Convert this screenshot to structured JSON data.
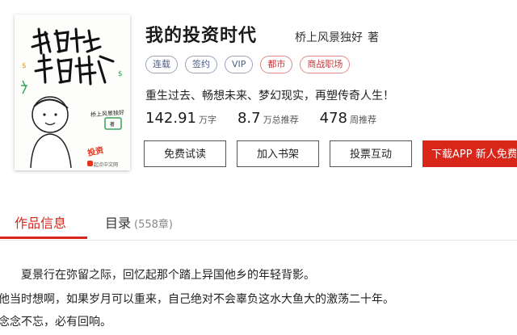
{
  "cover": {
    "title_art": "我的投资时代",
    "author": "桥上风景独好",
    "suffix": "著",
    "tag": "投资",
    "publisher": "起点中文网"
  },
  "book": {
    "title": "我的投资时代",
    "author": "桥上风景独好",
    "author_suffix": "著",
    "tags": [
      "连载",
      "签约",
      "VIP",
      "都市",
      "商战职场"
    ],
    "intro": "重生过去、畅想未来、梦幻现实，再塑传奇人生！",
    "stats": [
      {
        "num": "142.91",
        "unit": "万字"
      },
      {
        "num": "8.7",
        "unit": "万总推荐"
      },
      {
        "num": "478",
        "unit": "周推荐"
      }
    ]
  },
  "actions": {
    "free_read": "免费试读",
    "add_shelf": "加入书架",
    "vote": "投票互动",
    "download": "下载APP 新人免费"
  },
  "tabs": {
    "info": "作品信息",
    "catalog": "目录",
    "catalog_count": "(558章)"
  },
  "description": [
    "夏景行在弥留之际，回忆起那个踏上异国他乡的年轻背影。",
    "他当时想啊，如果岁月可以重来，自己绝对不会辜负这水大鱼大的激荡二十年。",
    "念念不忘，必有回响。"
  ]
}
